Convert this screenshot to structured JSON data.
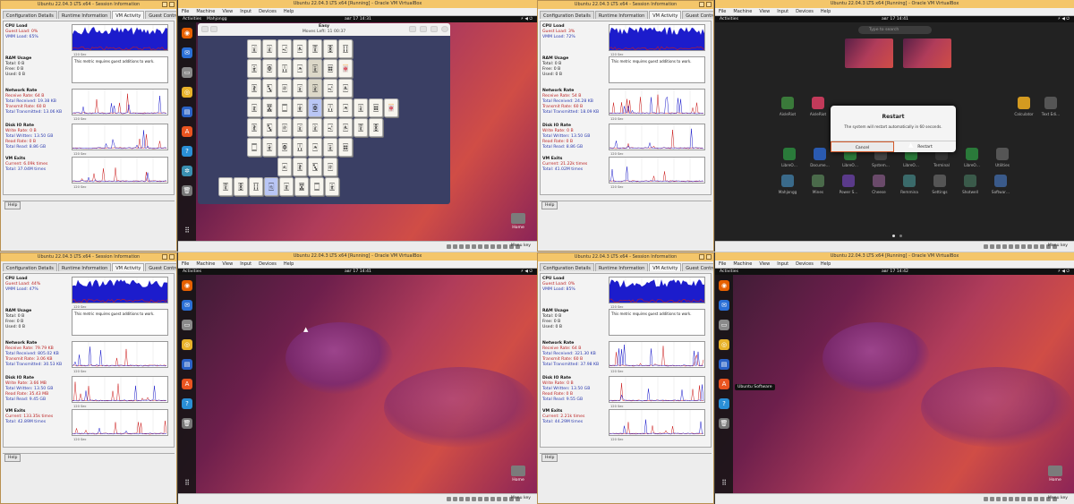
{
  "colors": {
    "accent": "#e95420",
    "title_bar": "#f4c66a",
    "graph_blue": "#1c1ccc",
    "graph_red": "#cc1c1c"
  },
  "session": {
    "title": "Ubuntu 22.04.3 LTS x64 - Session Information",
    "tabs": [
      "Configuration Details",
      "Runtime Information",
      "VM Activity",
      "Guest Control"
    ],
    "active_tab": "VM Activity",
    "help": "Help",
    "no_additions_msg": "This metric requires guest additions to work.",
    "tick": "120 Sec",
    "sections": {
      "cpu": "CPU Load",
      "ram": "RAM Usage",
      "net": "Network Rate",
      "disk": "Disk IO Rate",
      "exits": "VM Exits"
    },
    "ram_lines": [
      "Total: 0 B",
      "Free: 0 B",
      "Used: 0 B"
    ]
  },
  "vm": {
    "title": "Ubuntu 22.04.3 LTS x64 [Running] - Oracle VM VirtualBox",
    "menu": [
      "File",
      "Machine",
      "View",
      "Input",
      "Devices",
      "Help"
    ],
    "host_key": "Menu key",
    "activities": "Activities",
    "home_label": "Home"
  },
  "quadrants": [
    {
      "cpu": [
        "Guest Load: 0%",
        "VMM Load: 65%"
      ],
      "net": [
        "Receive Rate: 64 B",
        "Total Received: 19.38 KB",
        "Transmit Rate: 60 B",
        "Total Transmitted: 13.06 KB"
      ],
      "disk": [
        "Write Rate: 0 B",
        "Total Written: 13.50 GB",
        "Read Rate: 0 B",
        "Total Read: 8.86 GB"
      ],
      "exits": [
        "Current: 6.09k times",
        "Total: 37.04M times"
      ],
      "clock": "авг 17  14:31",
      "app": "Mahjongg"
    },
    {
      "cpu": [
        "Guest Load: 3%",
        "VMM Load: 72%"
      ],
      "net": [
        "Receive Rate: 54 B",
        "Total Received: 24.28 KB",
        "Transmit Rate: 60 B",
        "Total Transmitted: 18.09 KB"
      ],
      "disk": [
        "Write Rate: 0 B",
        "Total Written: 13.50 GB",
        "Read Rate: 0 B",
        "Total Read: 8.86 GB"
      ],
      "exits": [
        "Current: 21.22k times",
        "Total: 41.02M times"
      ],
      "clock": "авг 17  14:41",
      "app": ""
    },
    {
      "cpu": [
        "Guest Load: 44%",
        "VMM Load: 47%"
      ],
      "net": [
        "Receive Rate: 79.79 KB",
        "Total Received: 805.02 KB",
        "Transmit Rate: 3.06 KB",
        "Total Transmitted: 30.53 KB"
      ],
      "disk": [
        "Write Rate: 3.66 MB",
        "Total Written: 13.50 GB",
        "Read Rate: 35.43 MB",
        "Total Read: 9.45 GB"
      ],
      "exits": [
        "Current: 133.35k times",
        "Total: 42.89M times"
      ],
      "clock": "авг 17  14:41",
      "app": ""
    },
    {
      "cpu": [
        "Guest Load: 0%",
        "VMM Load: 85%"
      ],
      "net": [
        "Receive Rate: 64 B",
        "Total Received: 321.30 KB",
        "Transmit Rate: 60 B",
        "Total Transmitted: 37.98 KB"
      ],
      "disk": [
        "Write Rate: 0 B",
        "Total Written: 13.50 GB",
        "Read Rate: 0 B",
        "Total Read: 9.55 GB"
      ],
      "exits": [
        "Current: 2.21k times",
        "Total: 44.29M times"
      ],
      "clock": "авг 17  14:42",
      "app": ""
    }
  ],
  "mahjongg": {
    "title": "Easy",
    "status": "Moves Left: 11   00:37"
  },
  "overview": {
    "search": "Type to search",
    "apps": [
      "AisleRiot",
      "AisleRiot",
      "",
      "",
      "",
      "",
      "",
      "",
      "Calculator",
      "Text Edi…",
      "LibreO…",
      "Docume…",
      "LibreO…",
      "System…",
      "LibreO…",
      "Terminal",
      "LibreO…",
      "Utilities",
      "Mahjongg",
      "Mines",
      "Power S…",
      "Cheese",
      "Remmina",
      "Settings",
      "Shotwell",
      "Softwar…"
    ],
    "dialog_title": "Restart",
    "dialog_msg": "The system will restart automatically in 60 seconds.",
    "cancel": "Cancel",
    "restart": "Restart"
  },
  "tooltip": "Ubuntu Software",
  "tiles": [
    "🀇",
    "🀈",
    "🀉",
    "🀊",
    "🀋",
    "🀌",
    "🀍",
    "🀎",
    "🀏",
    "🀙",
    "🀚",
    "🀛",
    "🀜",
    "🀝",
    "🀐",
    "🀑",
    "🀒",
    "🀓",
    "🀅",
    "🀄",
    "🀆",
    "🀀",
    "🀁",
    "🀂",
    "🀃"
  ]
}
